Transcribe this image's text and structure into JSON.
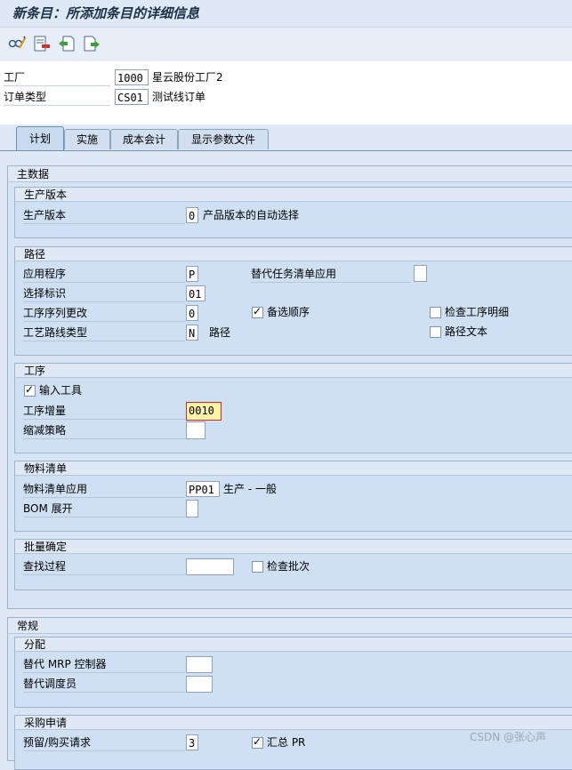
{
  "title": "新条目：所添加条目的详细信息",
  "toolbar": {
    "icons": [
      "glasses-edit-icon",
      "list-delete-icon",
      "copy-previous-icon",
      "copy-next-icon"
    ]
  },
  "header": {
    "plant_label": "工厂",
    "plant_value": "1000",
    "plant_desc": "星云股份工厂2",
    "order_type_label": "订单类型",
    "order_type_value": "CS01",
    "order_type_desc": "测试线订单"
  },
  "tabs": [
    {
      "label": "计划",
      "active": true
    },
    {
      "label": "实施",
      "active": false
    },
    {
      "label": "成本会计",
      "active": false
    },
    {
      "label": "显示参数文件",
      "active": false
    }
  ],
  "master_data": {
    "title": "主数据",
    "prod_version": {
      "title": "生产版本",
      "label": "生产版本",
      "value": "0",
      "desc": "产品版本的自动选择"
    },
    "routing": {
      "title": "路径",
      "application_label": "应用程序",
      "application_value": "P",
      "alt_task_list_label": "替代任务清单应用",
      "alt_task_list_value": "",
      "selection_id_label": "选择标识",
      "selection_id_value": "01",
      "seq_change_label": "工序序列更改",
      "seq_change_value": "0",
      "alt_sequence_label": "备选顺序",
      "alt_sequence_checked": true,
      "check_op_detail_label": "检查工序明细",
      "check_op_detail_checked": false,
      "routing_type_label": "工艺路线类型",
      "routing_type_value": "N",
      "routing_type_desc": "路径",
      "routing_text_label": "路径文本",
      "routing_text_checked": false
    },
    "operation": {
      "title": "工序",
      "enter_tool_label": "输入工具",
      "enter_tool_checked": true,
      "increment_label": "工序增量",
      "increment_value": "0010",
      "reduction_label": "缩减策略",
      "reduction_value": ""
    },
    "bom": {
      "title": "物料清单",
      "application_label": "物料清单应用",
      "application_value": "PP01",
      "application_desc": "生产 - 一般",
      "explosion_label": "BOM 展开",
      "explosion_value": ""
    },
    "batch": {
      "title": "批量确定",
      "search_label": "查找过程",
      "search_value": "",
      "check_batch_label": "检查批次",
      "check_batch_checked": false
    }
  },
  "general": {
    "title": "常规",
    "assignment": {
      "title": "分配",
      "alt_mrp_label": "替代 MRP 控制器",
      "alt_mrp_value": "",
      "alt_scheduler_label": "替代调度员",
      "alt_scheduler_value": ""
    },
    "purchase_req": {
      "title": "采购申请",
      "reservation_label": "预留/购买请求",
      "reservation_value": "3",
      "collective_pr_label": "汇总 PR",
      "collective_pr_checked": true
    }
  },
  "watermark": "CSDN @张心声"
}
